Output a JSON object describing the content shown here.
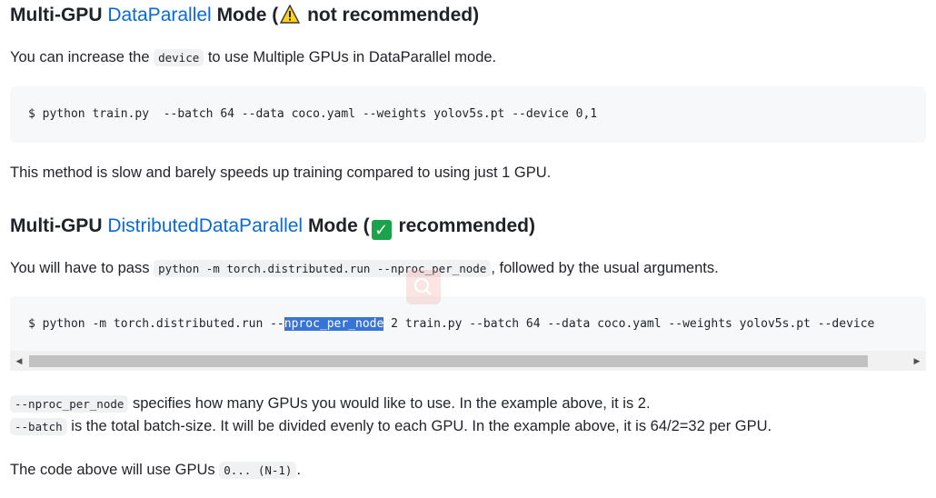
{
  "section1": {
    "heading_prefix": "Multi-GPU ",
    "heading_link": "DataParallel",
    "heading_mid": " Mode (",
    "heading_suffix": " not recommended)",
    "intro_before": "You can increase the ",
    "intro_code": "device",
    "intro_after": " to use Multiple GPUs in DataParallel mode.",
    "command": "$ python train.py  --batch 64 --data coco.yaml --weights yolov5s.pt --device 0,1",
    "note": "This method is slow and barely speeds up training compared to using just 1 GPU."
  },
  "section2": {
    "heading_prefix": "Multi-GPU ",
    "heading_link": "DistributedDataParallel",
    "heading_mid": " Mode (",
    "heading_suffix": " recommended)",
    "intro_before": "You will have to pass ",
    "intro_code": "python -m torch.distributed.run --nproc_per_node",
    "intro_after": ", followed by the usual arguments.",
    "command_before": "$ python -m torch.distributed.run --",
    "command_highlight": "nproc_per_node",
    "command_after": " 2 train.py --batch 64 --data coco.yaml --weights yolov5s.pt --device",
    "line1_code": "--nproc_per_node",
    "line1_text": " specifies how many GPUs you would like to use. In the example above, it is 2.",
    "line2_code": "--batch",
    "line2_text": "  is the total batch-size. It will be divided evenly to each GPU. In the example above, it is 64/2=32 per GPU.",
    "final_before": "The code above will use GPUs ",
    "final_code": "0... (N-1)",
    "final_after": "."
  },
  "icons": {
    "warning": "warning-icon",
    "check": "check-mark-icon",
    "search": "search-icon"
  },
  "colors": {
    "link": "#0969da",
    "highlight": "#3874d8",
    "check": "#1aa34a"
  }
}
